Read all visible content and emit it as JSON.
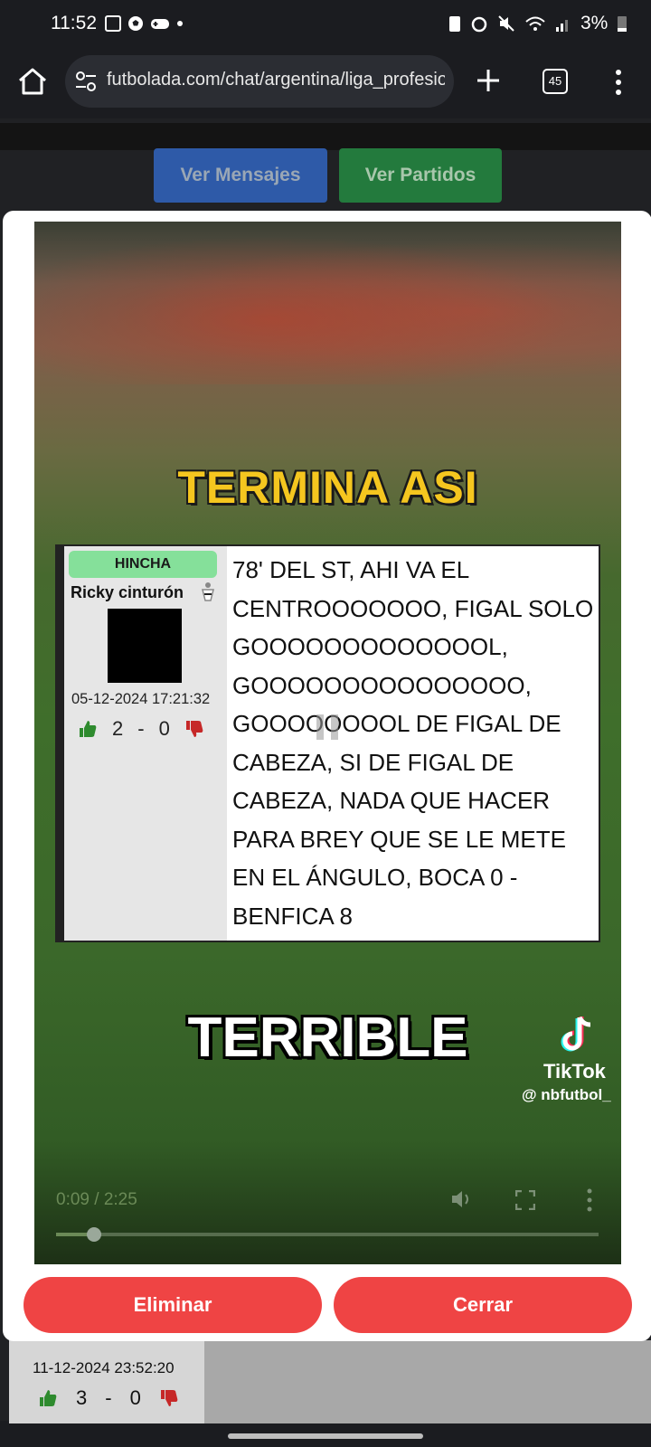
{
  "status_bar": {
    "time": "11:52",
    "battery": "3%"
  },
  "browser": {
    "url": "futbolada.com/chat/argentina/liga_profesio",
    "tab_count": "45"
  },
  "page": {
    "ver_mensajes": "Ver Mensajes",
    "ver_partidos": "Ver Partidos",
    "bottom_card": {
      "date": "11-12-2024 23:52:20",
      "likes": "3",
      "separator": "-",
      "dislikes": "0"
    }
  },
  "modal": {
    "video": {
      "overlay_title": "TERMINA ASI",
      "overlay_bottom": "TERRIBLE",
      "chat_card": {
        "badge": "HINCHA",
        "username": "Ricky cinturón",
        "date": "05-12-2024 17:21:32",
        "likes": "2",
        "separator": "-",
        "dislikes": "0",
        "message": "78' DEL ST, AHI VA EL CENTROOOOOOO, FIGAL SOLO GOOOOOOOOOOOOOL, GOOOOOOOOOOOOOOO, GOOOOOOOOL DE FIGAL DE CABEZA, SI DE FIGAL DE CABEZA, NADA QUE HACER PARA BREY QUE SE LE METE EN EL ÁNGULO, BOCA 0 - BENFICA 8"
      },
      "watermark_brand": "TikTok",
      "watermark_handle": "@ nbfutbol_",
      "time_display": "0:09 / 2:25",
      "progress": 0.07
    },
    "eliminar_label": "Eliminar",
    "cerrar_label": "Cerrar"
  },
  "colors": {
    "red_button": "#ef4444",
    "blue_button": "#2e5aa8",
    "green_button": "#237a3d",
    "badge_green": "#85e09a",
    "title_yellow": "#f5c61f"
  }
}
